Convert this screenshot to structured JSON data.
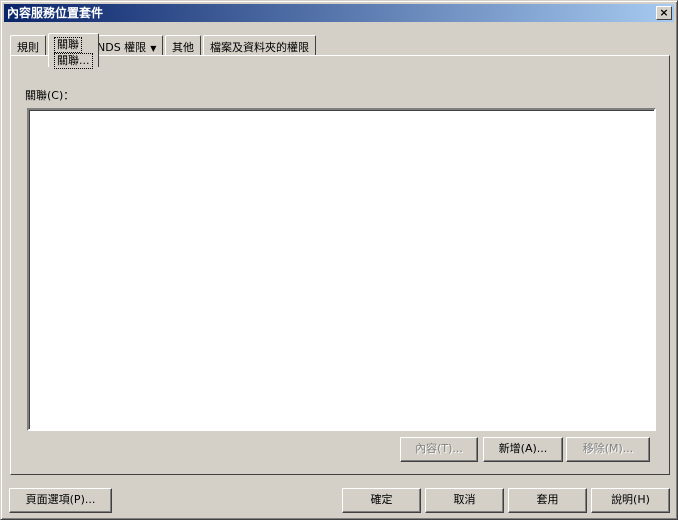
{
  "window": {
    "title": "內容服務位置套件",
    "close_label": "×"
  },
  "tabs": [
    {
      "label": "規則"
    },
    {
      "label": "關聯",
      "sub_label": "關聯..."
    },
    {
      "label": "NDS 權限"
    },
    {
      "label": "其他"
    },
    {
      "label": "檔案及資料夾的權限"
    }
  ],
  "panel": {
    "list_label": "關聯(C)："
  },
  "list_buttons": {
    "properties": "內容(T)...",
    "add": "新增(A)...",
    "remove": "移除(M)..."
  },
  "footer": {
    "page_options": "頁面選項(P)...",
    "ok": "確定",
    "cancel": "取消",
    "apply": "套用",
    "help": "說明(H)"
  }
}
